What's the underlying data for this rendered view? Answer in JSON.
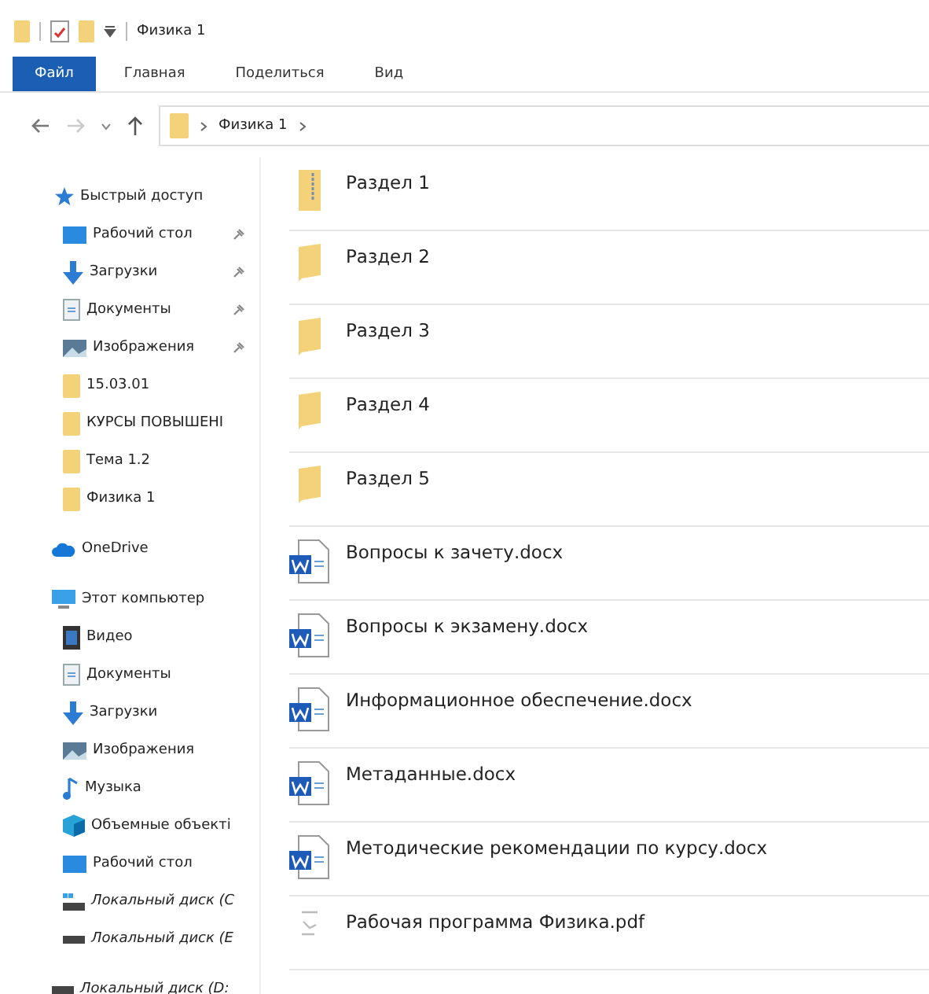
{
  "title_bar": {
    "title": "Физика 1"
  },
  "ribbon_tabs": [
    {
      "label": "Файл",
      "selected": true
    },
    {
      "label": "Главная",
      "selected": false
    },
    {
      "label": "Поделиться",
      "selected": false
    },
    {
      "label": "Вид",
      "selected": false
    }
  ],
  "address_bar": {
    "path": [
      "Физика 1"
    ]
  },
  "sidebar": {
    "sections": [
      {
        "label": "Быстрый доступ",
        "kind": "star",
        "children": [
          {
            "label": "Рабочий стол",
            "kind": "desktop",
            "pinned": true
          },
          {
            "label": "Загрузки",
            "kind": "download",
            "pinned": true
          },
          {
            "label": "Документы",
            "kind": "document",
            "pinned": true
          },
          {
            "label": "Изображения",
            "kind": "image",
            "pinned": true
          },
          {
            "label": "15.03.01",
            "kind": "folder",
            "pinned": false
          },
          {
            "label": "КУРСЫ ПОВЫШЕНІ",
            "kind": "folder",
            "pinned": false
          },
          {
            "label": "Тема 1.2",
            "kind": "folder",
            "pinned": false
          },
          {
            "label": "Физика 1",
            "kind": "folder",
            "pinned": false
          }
        ]
      },
      {
        "label": "OneDrive",
        "kind": "cloud"
      },
      {
        "label": "Этот компьютер",
        "kind": "computer",
        "children": [
          {
            "label": "Видео",
            "kind": "video"
          },
          {
            "label": "Документы",
            "kind": "document"
          },
          {
            "label": "Загрузки",
            "kind": "download"
          },
          {
            "label": "Изображения",
            "kind": "image"
          },
          {
            "label": "Музыка",
            "kind": "music"
          },
          {
            "label": "Объемные объекті",
            "kind": "cube"
          },
          {
            "label": "Рабочий стол",
            "kind": "desktop"
          },
          {
            "label": "Локальный диск (C",
            "kind": "system-drive"
          },
          {
            "label": "Локальный диск (E",
            "kind": "drive"
          }
        ]
      },
      {
        "label": "Локальный диск (D:",
        "kind": "drive"
      }
    ]
  },
  "files": [
    {
      "name": "Раздел 1",
      "kind": "zip"
    },
    {
      "name": "Раздел 2",
      "kind": "folder"
    },
    {
      "name": "Раздел 3",
      "kind": "folder"
    },
    {
      "name": "Раздел 4",
      "kind": "folder"
    },
    {
      "name": "Раздел 5",
      "kind": "folder"
    },
    {
      "name": "Вопросы к зачету.docx",
      "kind": "docx"
    },
    {
      "name": "Вопросы к экзамену.docx",
      "kind": "docx"
    },
    {
      "name": "Информационное обеспечение.docx",
      "kind": "docx"
    },
    {
      "name": "Метаданные.docx",
      "kind": "docx"
    },
    {
      "name": "Методические рекомендации по курсу.docx",
      "kind": "docx"
    },
    {
      "name": "Рабочая программа Физика.pdf",
      "kind": "pdf"
    }
  ]
}
